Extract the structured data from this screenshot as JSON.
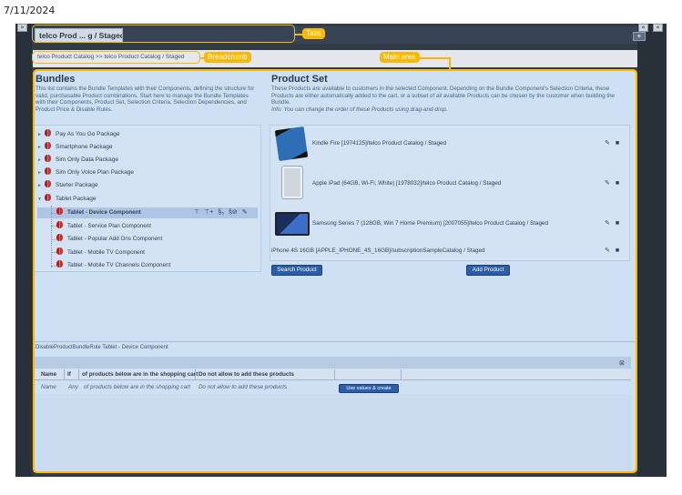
{
  "date": "7/11/2024",
  "annotations": {
    "tabs": "Tabs",
    "breadcrumb": "Breadcrumb",
    "main_area": "Main area"
  },
  "tabs": {
    "active_label": "telco Prod ... g / Staged",
    "add_label": "+"
  },
  "breadcrumb": "telco Product Catalog >> telco Product Catalog / Staged",
  "bundles": {
    "title": "Bundles",
    "description": "This list contains the Bundle Templates with their Components, defining the structure for valid, purchasable Product combinations. Start here to manage the Bundle Templates with their Components, Product Set, Selection Criteria, Selection Dependencies, and Product Price & Disable Rules.",
    "items": [
      "Pay As You Go Package",
      "Smartphone Package",
      "Sim Only Data Package",
      "Sim Only Voice Plan Package",
      "Starter Package",
      "Tablet Package"
    ],
    "children": [
      "Tablet - Device Component",
      "Tablet - Service Plan Component",
      "Tablet - Popular Add Ons Component",
      "Tablet - Mobile TV Component",
      "Tablet - Mobile TV Channels Component"
    ]
  },
  "product_set": {
    "title": "Product Set",
    "description": "These Products are available to customers in the selected Component. Depending on the Bundle Component's Selection Criteria, these Products are either automatically added to the cart, or a subset of all available Products can be chosen by the customer when building the Bundle.",
    "info": "Info: You can change the order of these Products using drag-and-drop.",
    "products": [
      "Kindle Fire [1974125]/telco Product Catalog / Staged",
      "Apple iPad (64GB, Wi-Fi, White) [1978032]/telco Product Catalog / Staged",
      "Samsung Series 7 (128GB, Win 7 Home Premium) [2007055]/telco Product Catalog / Staged",
      "iPhone 4S 16GB [APPLE_IPHONE_4S_16GB]/subscriptionSampleCatalog / Staged"
    ],
    "search_button": "Search Product",
    "add_button": "Add Product"
  },
  "rules": {
    "title": "DisableProductBundleRule Tablet - Device Component",
    "columns": [
      "Name",
      "If",
      "of products below are in the shopping cart",
      "Do not allow to add these products"
    ],
    "row": [
      "Name",
      "Any",
      "of products below are in the shopping cart",
      "Do not allow to add these products"
    ],
    "row_button": "Use values & create"
  },
  "colors": {
    "accent": "#ffb800",
    "frame": "#333b47",
    "main_bg": "#cde0f4",
    "button": "#2e5da8"
  }
}
